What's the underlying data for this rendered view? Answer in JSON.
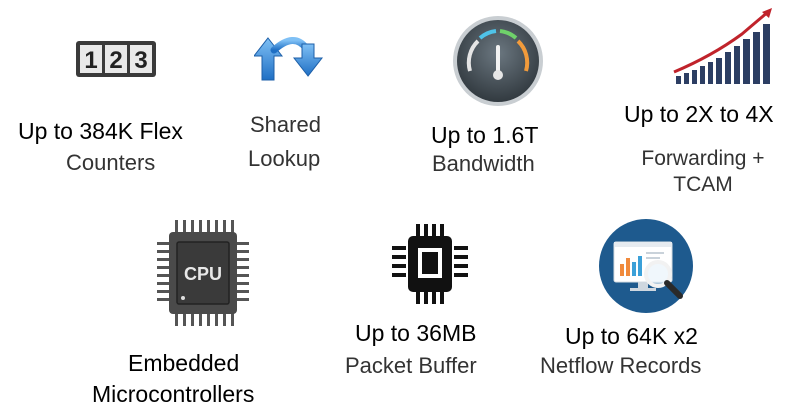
{
  "features": [
    {
      "icon": "counter-digits-icon",
      "counter_digits": [
        "1",
        "2",
        "3"
      ],
      "main": "Up to 384K Flex",
      "sub": "Counters"
    },
    {
      "icon": "shared-lookup-arrows-icon",
      "line1": "Shared",
      "line2": "Lookup"
    },
    {
      "icon": "speedometer-gauge-icon",
      "main": "Up to 1.6T",
      "sub": "Bandwidth"
    },
    {
      "icon": "growth-bar-chart-icon",
      "main": "Up to 2X to 4X",
      "sub_line1": "Forwarding +",
      "sub_line2": "TCAM"
    },
    {
      "icon": "cpu-chip-icon",
      "chip_label": "CPU",
      "main_line1": "Embedded",
      "main_line2": "Microcontrollers"
    },
    {
      "icon": "memory-chip-icon",
      "main": "Up to 36MB",
      "sub": "Packet Buffer"
    },
    {
      "icon": "analytics-magnifier-icon",
      "main": "Up to 64K x2",
      "sub": "Netflow Records"
    }
  ],
  "colors": {
    "text_main": "#000000",
    "text_sub": "#333333",
    "arrow_blue": "#2a7fd4",
    "gauge_dark": "#3f4a52",
    "growth_red": "#c0232b",
    "bars_navy": "#2c3e63",
    "monitor_blue": "#1e5a8e"
  }
}
